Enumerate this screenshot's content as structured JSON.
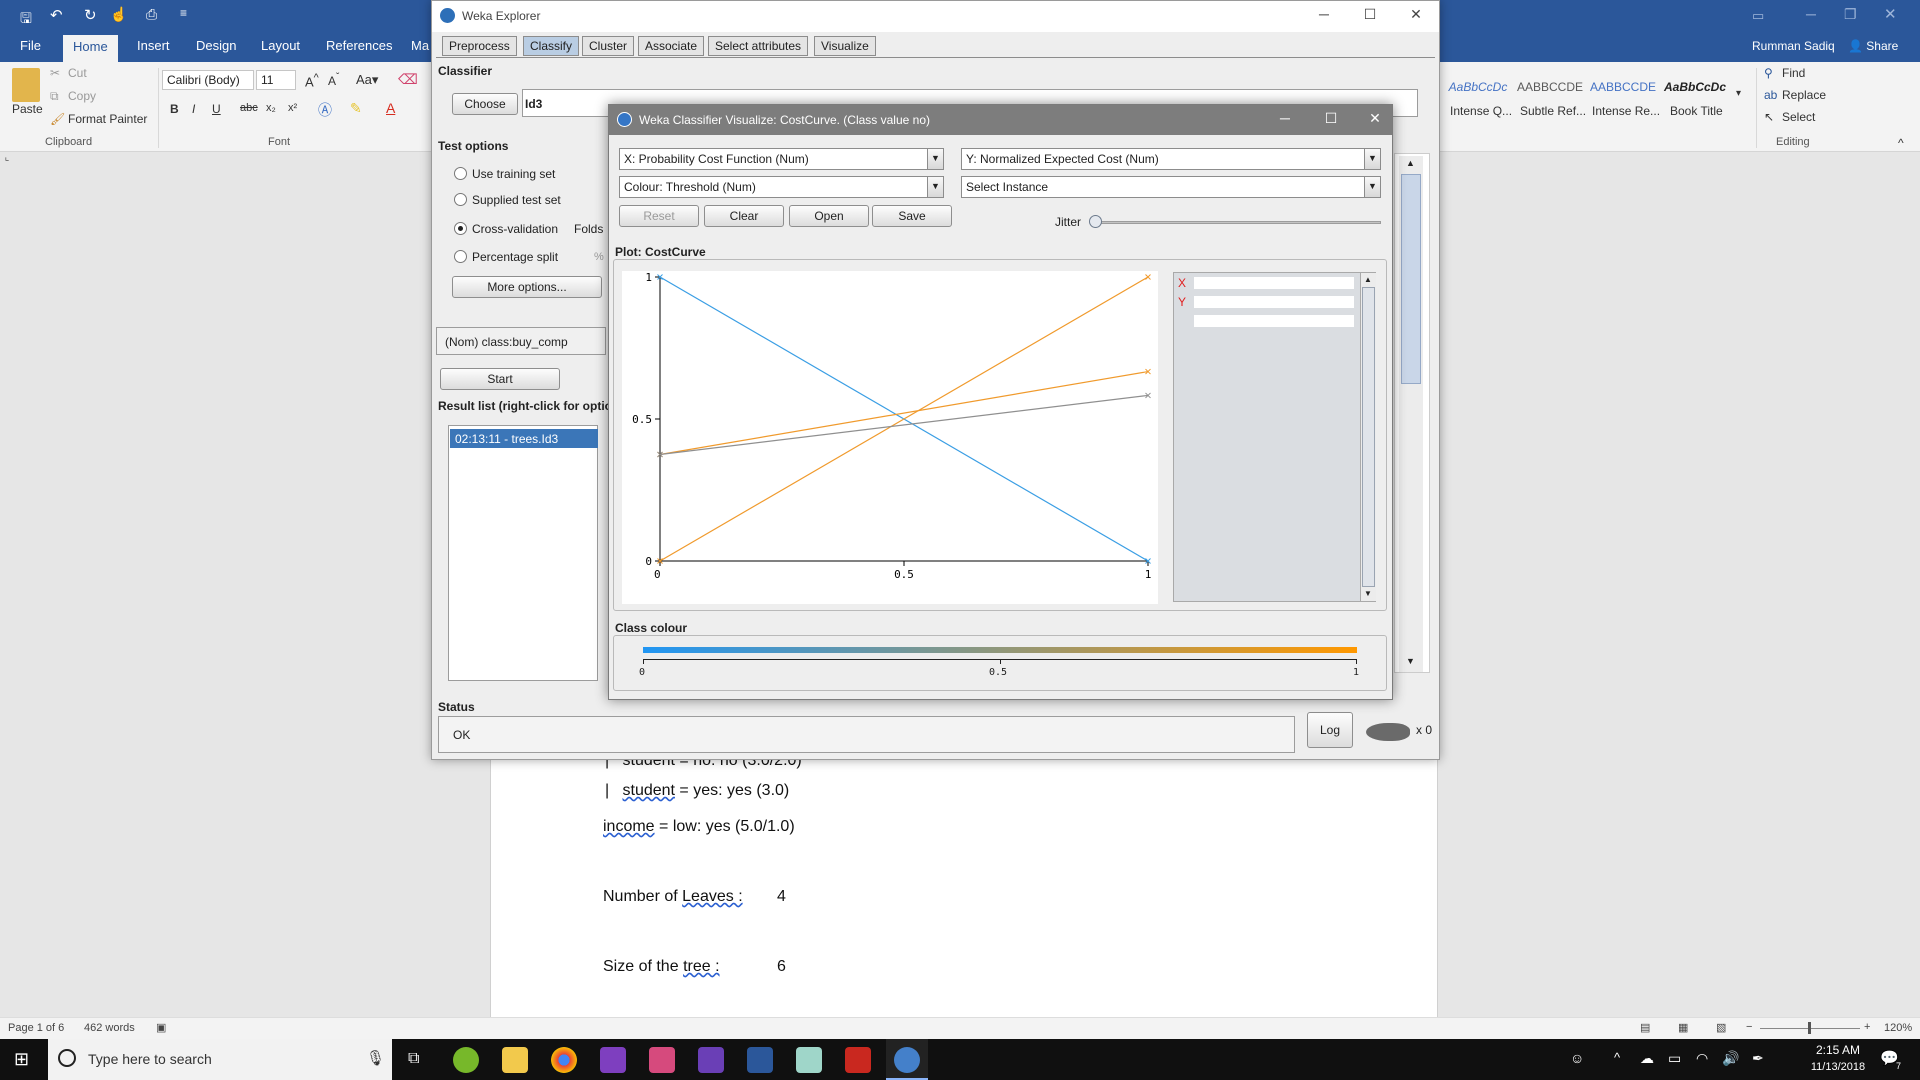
{
  "word": {
    "quick_access": [
      "save-icon",
      "undo-icon",
      "redo-icon",
      "touch-icon",
      "print-preview-icon"
    ],
    "tabs": [
      {
        "label": "File"
      },
      {
        "label": "Home"
      },
      {
        "label": "Insert"
      },
      {
        "label": "Design"
      },
      {
        "label": "Layout"
      },
      {
        "label": "References"
      },
      {
        "label": "Ma"
      }
    ],
    "user": "Rumman Sadiq",
    "share": "Share",
    "clipboard": {
      "paste": "Paste",
      "cut": "Cut",
      "copy": "Copy",
      "format_painter": "Format Painter",
      "label": "Clipboard"
    },
    "font": {
      "name": "Calibri (Body)",
      "size": "11",
      "label": "Font"
    },
    "styles": [
      {
        "preview": "AaBbCcDc",
        "name": "Intense Q...",
        "color": "#4472c4"
      },
      {
        "preview": "AABBCCDE",
        "name": "Subtle Ref...",
        "color": "#595959"
      },
      {
        "preview": "AABBCCDE",
        "name": "Intense Re...",
        "color": "#4472c4"
      },
      {
        "preview": "AaBbCcDc",
        "name": "Book Title",
        "color": "#222222"
      }
    ],
    "editing": {
      "find": "Find",
      "replace": "Replace",
      "select": "Select",
      "label": "Editing"
    },
    "doc_lines": {
      "line1_bar": "|",
      "line1": "student = no: no (3.0/2.0)",
      "line2_bar": "|",
      "line2_word": "student",
      "line2_rest": " = yes: yes (3.0)",
      "line3_word": "income",
      "line3_rest": " = low: yes (5.0/1.0)",
      "line4_label": "Number of",
      "line4_word": "Leaves :",
      "line4_value": "4",
      "line5_label": "Size of the",
      "line5_word": "tree :",
      "line5_value": "6"
    },
    "status": {
      "page": "Page 1 of 6",
      "words": "462 words",
      "zoom": "120%"
    }
  },
  "taskbar": {
    "search_placeholder": "Type here to search",
    "time": "2:15 AM",
    "date": "11/13/2018",
    "notification_count": "7"
  },
  "explorer": {
    "title": "Weka Explorer",
    "tabs": [
      {
        "label": "Preprocess"
      },
      {
        "label": "Classify"
      },
      {
        "label": "Cluster"
      },
      {
        "label": "Associate"
      },
      {
        "label": "Select attributes"
      },
      {
        "label": "Visualize"
      }
    ],
    "classifier_label": "Classifier",
    "choose_button": "Choose",
    "classifier_name": "Id3",
    "test_options_label": "Test options",
    "options": {
      "training_set": "Use training set",
      "supplied": "Supplied test set",
      "cross_val": "Cross-validation",
      "folds": "Folds",
      "percentage": "Percentage split",
      "pct": "%"
    },
    "more_options": "More options...",
    "class_select": "(Nom) class:buy_comp",
    "start_button": "Start",
    "result_list_label": "Result list (right-click for optio",
    "result_item": "02:13:11 - trees.Id3",
    "status_label": "Status",
    "status_text": "OK",
    "log_button": "Log",
    "x_count": "x 0"
  },
  "viz": {
    "title": "Weka Classifier Visualize: CostCurve. (Class value no)",
    "x_combo": "X: Probability Cost Function (Num)",
    "y_combo": "Y: Normalized Expected Cost (Num)",
    "colour_combo": "Colour: Threshold (Num)",
    "instance_combo": "Select Instance",
    "reset": "Reset",
    "clear": "Clear",
    "open": "Open",
    "save": "Save",
    "jitter": "Jitter",
    "plot_label": "Plot: CostCurve",
    "legend_x": "X",
    "legend_y": "Y",
    "class_colour_label": "Class colour",
    "class_ticks": [
      "0",
      "0.5",
      "1"
    ]
  },
  "chart_data": {
    "type": "line",
    "x": [
      0,
      1
    ],
    "xlim": [
      0,
      1
    ],
    "ylim": [
      0,
      1
    ],
    "x_ticks": [
      "0",
      "0.5",
      "1"
    ],
    "y_ticks": [
      "0",
      "0.5",
      "1"
    ],
    "series": [
      {
        "values": [
          1,
          0
        ],
        "color": "#3a9ee4"
      },
      {
        "values": [
          0,
          1
        ],
        "color": "#f09a2c"
      },
      {
        "values": [
          0.375,
          0.667
        ],
        "color": "#f09a2c"
      },
      {
        "values": [
          0.375,
          0.583
        ],
        "color": "#8f8f8f"
      }
    ],
    "colour_scale": {
      "start": "#2196f3",
      "end": "#ff9800"
    }
  }
}
